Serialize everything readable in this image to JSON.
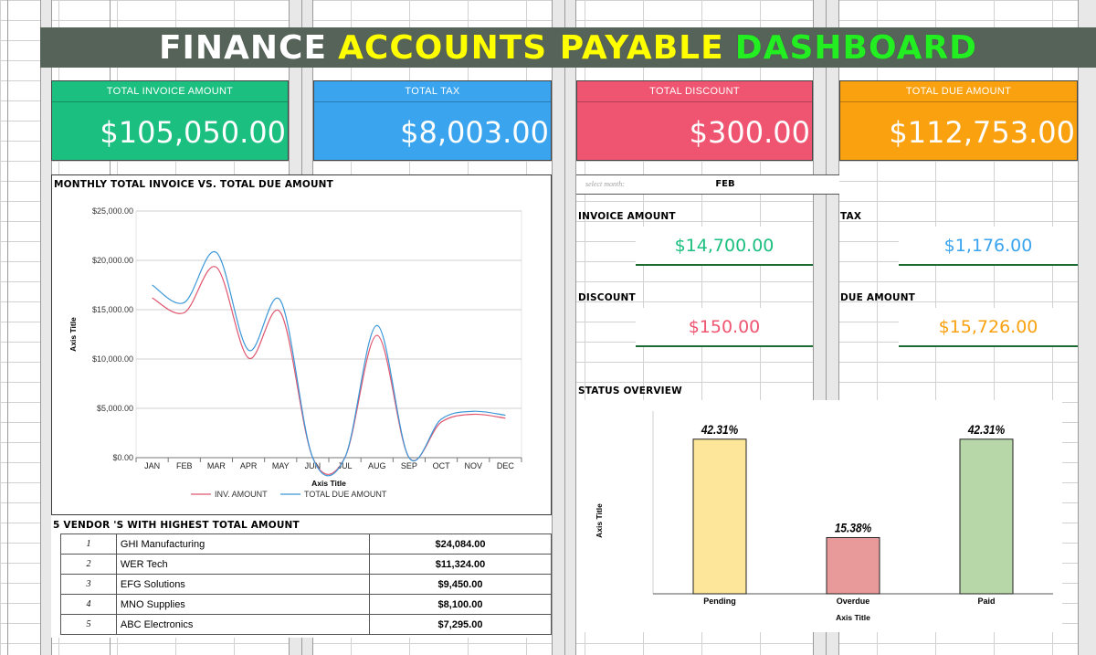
{
  "title": {
    "part1": "FINANCE",
    "part2": "ACCOUNTS PAYABLE",
    "part3": "DASHBOARD"
  },
  "colors": {
    "green": "#1bbf7f",
    "blue": "#3aa4ee",
    "red": "#ef5470",
    "orange": "#f9a10f"
  },
  "kpis": [
    {
      "label": "TOTAL INVOICE AMOUNT",
      "value": "$105,050.00"
    },
    {
      "label": "TOTAL TAX",
      "value": "$8,003.00"
    },
    {
      "label": "TOTAL DISCOUNT",
      "value": "$300.00"
    },
    {
      "label": "TOTAL DUE AMOUNT",
      "value": "$112,753.00"
    }
  ],
  "month_selector": {
    "label": "select month:",
    "value": "FEB"
  },
  "month_stats": {
    "invoice": {
      "label": "INVOICE AMOUNT",
      "value": "$14,700.00"
    },
    "tax": {
      "label": "TAX",
      "value": "$1,176.00"
    },
    "discount": {
      "label": "DISCOUNT",
      "value": "$150.00"
    },
    "due": {
      "label": "DUE AMOUNT",
      "value": "$15,726.00"
    }
  },
  "line_section": {
    "title": "MONTHLY TOTAL INVOICE VS. TOTAL DUE AMOUNT"
  },
  "status_section": {
    "title": "STATUS OVERVIEW"
  },
  "vendor_section": {
    "title": "5 VENDOR 'S WITH HIGHEST TOTAL AMOUNT",
    "rows": [
      {
        "rank": "1",
        "name": "GHI Manufacturing",
        "amount": "$24,084.00"
      },
      {
        "rank": "2",
        "name": "WER Tech",
        "amount": "$11,324.00"
      },
      {
        "rank": "3",
        "name": "EFG Solutions",
        "amount": "$9,450.00"
      },
      {
        "rank": "4",
        "name": "MNO Supplies",
        "amount": "$8,100.00"
      },
      {
        "rank": "5",
        "name": "ABC Electronics",
        "amount": "$7,295.00"
      }
    ]
  },
  "chart_data": [
    {
      "type": "line",
      "title": "",
      "xlabel": "Axis Title",
      "ylabel": "Axis Title",
      "categories": [
        "JAN",
        "FEB",
        "MAR",
        "APR",
        "MAY",
        "JUN",
        "JUL",
        "AUG",
        "SEP",
        "OCT",
        "NOV",
        "DEC"
      ],
      "ylim": [
        0,
        25000
      ],
      "yticks": [
        "$0.00",
        "$5,000.00",
        "$10,000.00",
        "$15,000.00",
        "$20,000.00",
        "$25,000.00"
      ],
      "legend": "bottom",
      "grid": true,
      "series": [
        {
          "name": "INV. AMOUNT",
          "color": "#e0566f",
          "values": [
            16200,
            14700,
            19300,
            10100,
            14700,
            0,
            0,
            12400,
            0,
            3600,
            4400,
            4000
          ]
        },
        {
          "name": "TOTAL DUE AMOUNT",
          "color": "#3b97d8",
          "values": [
            17500,
            15726,
            20800,
            10900,
            15900,
            0,
            0,
            13400,
            0,
            3900,
            4700,
            4300
          ]
        }
      ]
    },
    {
      "type": "bar",
      "title": "",
      "xlabel": "Axis Title",
      "ylabel": "Axis Title",
      "categories": [
        "Pending",
        "Overdue",
        "Paid"
      ],
      "values": [
        42.31,
        15.38,
        42.31
      ],
      "data_labels": [
        "42.31%",
        "15.38%",
        "42.31%"
      ],
      "ylim": [
        0,
        50
      ],
      "colors": [
        "#fde59a",
        "#e89999",
        "#b7d7a8"
      ]
    }
  ]
}
